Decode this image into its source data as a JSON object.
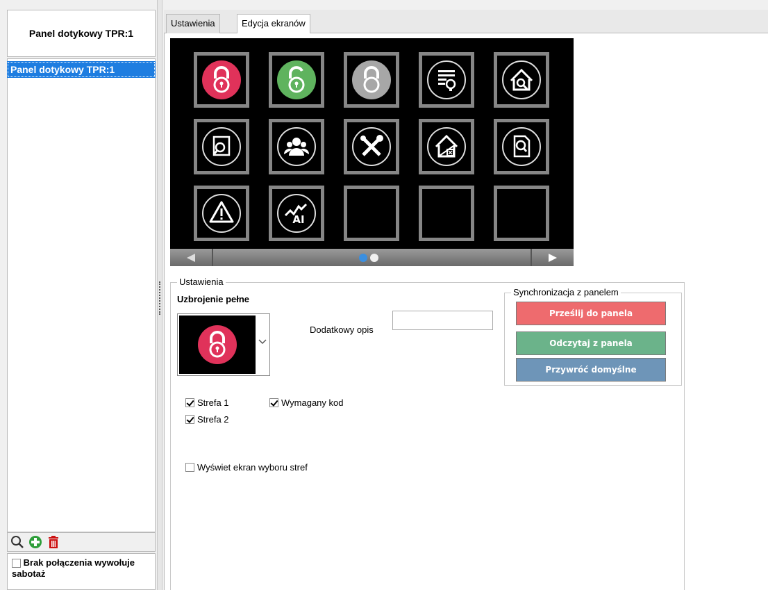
{
  "left": {
    "header_title": "Panel dotykowy TPR:1",
    "list_items": [
      "Panel dotykowy TPR:1"
    ],
    "footer_checkbox_label": "Brak połączenia wywołuje sabotaż",
    "footer_checkbox_checked": false
  },
  "tabs": [
    {
      "label": "Ustawienia",
      "active": false
    },
    {
      "label": "Edycja  ekranów",
      "active": true
    }
  ],
  "preview": {
    "tiles": [
      {
        "icon": "lock-red-icon"
      },
      {
        "icon": "lock-green-icon"
      },
      {
        "icon": "lock-grey-icon"
      },
      {
        "icon": "bulletin-bulb-icon"
      },
      {
        "icon": "house-search-icon"
      },
      {
        "icon": "document-search-icon"
      },
      {
        "icon": "users-icon"
      },
      {
        "icon": "tools-icon"
      },
      {
        "icon": "house-cross-icon"
      },
      {
        "icon": "file-search-icon"
      },
      {
        "icon": "warning-icon"
      },
      {
        "icon": "analog-input-icon"
      },
      {
        "icon": "empty"
      },
      {
        "icon": "empty"
      },
      {
        "icon": "empty"
      }
    ],
    "page_count": 2,
    "current_page": 1,
    "analog_input_text": "AI"
  },
  "settings": {
    "legend": "Ustawienia",
    "mode_title": "Uzbrojenie pełne",
    "selected_icon": "lock-red-icon",
    "desc_label": "Dodatkowy opis",
    "desc_value": "",
    "zone1_label": "Strefa 1",
    "zone1_checked": true,
    "zone2_label": "Strefa 2",
    "zone2_checked": true,
    "code_label": "Wymagany kod",
    "code_checked": true,
    "zone_screen_label": "Wyświet ekran wyboru stref",
    "zone_screen_checked": false
  },
  "sync": {
    "legend": "Synchronizacja z panelem",
    "send_label": "Prześlij do panela",
    "read_label": "Odczytaj z panela",
    "restore_label": "Przywróć domyślne"
  },
  "colors": {
    "selection": "#1e7de0",
    "send_button": "#ee6b6e",
    "read_button": "#6bb38a",
    "restore_button": "#6e95b8",
    "lock_red": "#e0325a",
    "lock_green": "#5fb35e",
    "lock_grey": "#a7a7a7"
  }
}
